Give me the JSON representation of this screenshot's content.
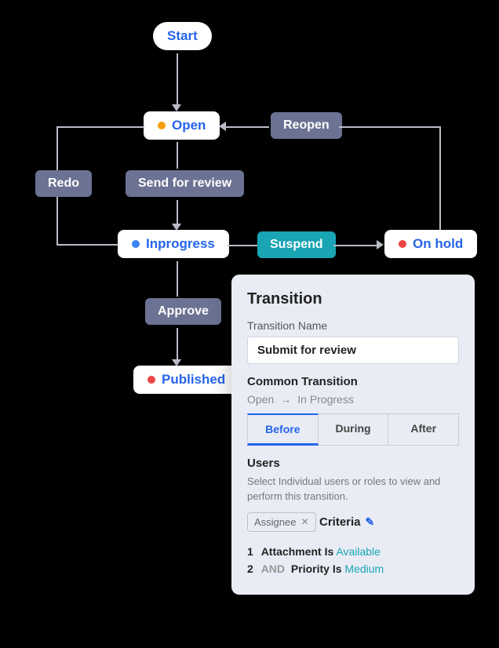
{
  "nodes": {
    "start": "Start",
    "open": "Open",
    "inprogress": "Inprogress",
    "onhold": "On hold",
    "published": "Published"
  },
  "transitions": {
    "reopen": "Reopen",
    "redo": "Redo",
    "send_for_review": "Send for review",
    "suspend": "Suspend",
    "approve": "Approve"
  },
  "panel": {
    "title": "Transition",
    "name_label": "Transition Name",
    "name_value": "Submit for review",
    "common_title": "Common Transition",
    "common_from": "Open",
    "common_arrow": "→",
    "common_to": "In Progress",
    "tabs": {
      "before": "Before",
      "during": "During",
      "after": "After"
    },
    "users": {
      "title": "Users",
      "help": "Select Individual users or roles to view and perform this transition.",
      "chip": "Assignee"
    },
    "criteria": {
      "title": "Criteria",
      "rows": [
        {
          "num": "1",
          "op": "",
          "field": "Attachment Is",
          "value": "Available"
        },
        {
          "num": "2",
          "op": "AND",
          "field": "Priority Is",
          "value": "Medium"
        }
      ]
    }
  }
}
